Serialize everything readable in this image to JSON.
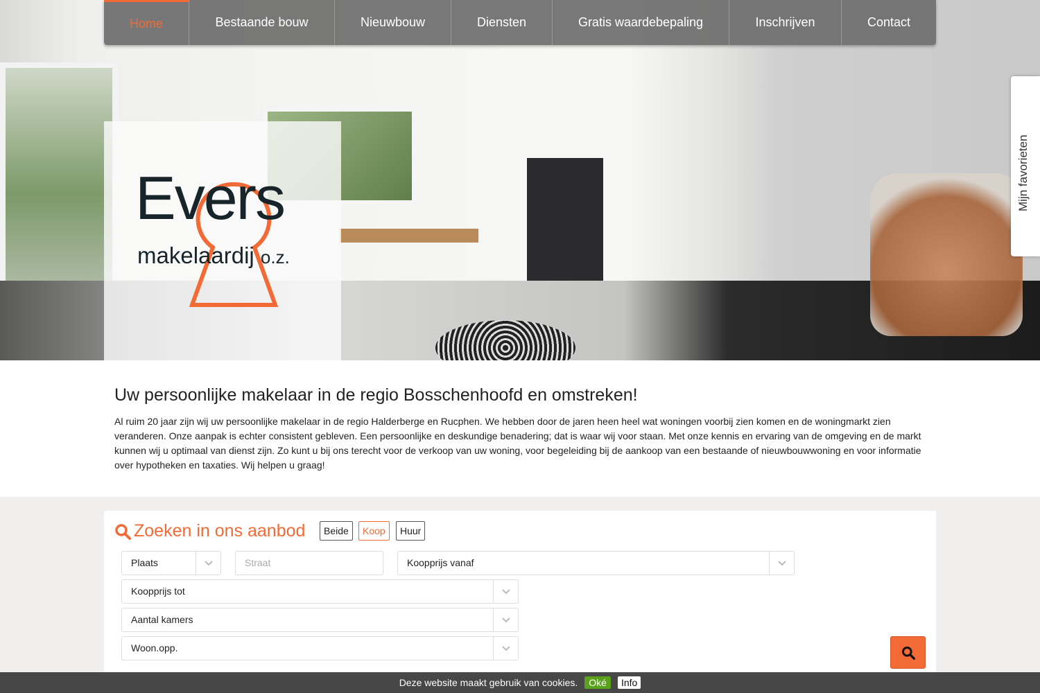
{
  "nav": {
    "items": [
      {
        "label": "Home",
        "active": true
      },
      {
        "label": "Bestaande bouw"
      },
      {
        "label": "Nieuwbouw"
      },
      {
        "label": "Diensten"
      },
      {
        "label": "Gratis waardebepaling"
      },
      {
        "label": "Inschrijven"
      },
      {
        "label": "Contact"
      }
    ]
  },
  "logo": {
    "name": "Evers",
    "sub": "makelaardij",
    "suffix": "o.z."
  },
  "favorites_tab": "Mijn favorieten",
  "intro": {
    "title": "Uw persoonlijke makelaar in de regio Bosschenhoofd en omstreken!",
    "body": "Al ruim 20 jaar zijn wij uw persoonlijke makelaar in de regio Halderberge en Rucphen. We hebben door de jaren heen heel wat woningen voorbij zien komen en de woningmarkt zien veranderen. Onze aanpak is echter consistent gebleven. Een persoonlijke en deskundige benadering; dat is waar wij voor staan. Met onze kennis en ervaring van de omgeving en de markt kunnen wij u optimaal van dienst zijn. Zo kunt u bij ons terecht voor de verkoop van uw woning, voor begeleiding bij de aankoop van een bestaande of nieuwbouwwoning en voor informatie over hypotheken en taxaties. Wij helpen u graag!"
  },
  "search": {
    "title": "Zoeken in ons aanbod",
    "toggles": [
      "Beide",
      "Koop",
      "Huur"
    ],
    "active_toggle": "Koop",
    "plaats": "Plaats",
    "straat_placeholder": "Straat",
    "koopprijs_vanaf": "Koopprijs vanaf",
    "koopprijs_tot": "Koopprijs tot",
    "aantal_kamers": "Aantal kamers",
    "woon_opp": "Woon.opp."
  },
  "cookie": {
    "text": "Deze website maakt gebruik van cookies.",
    "ok": "Oké",
    "info": "Info"
  },
  "colors": {
    "accent": "#f26b36",
    "nav_bg": "#6e6e6e",
    "cookie_bg": "#474747",
    "ok_green": "#5aa11c"
  }
}
